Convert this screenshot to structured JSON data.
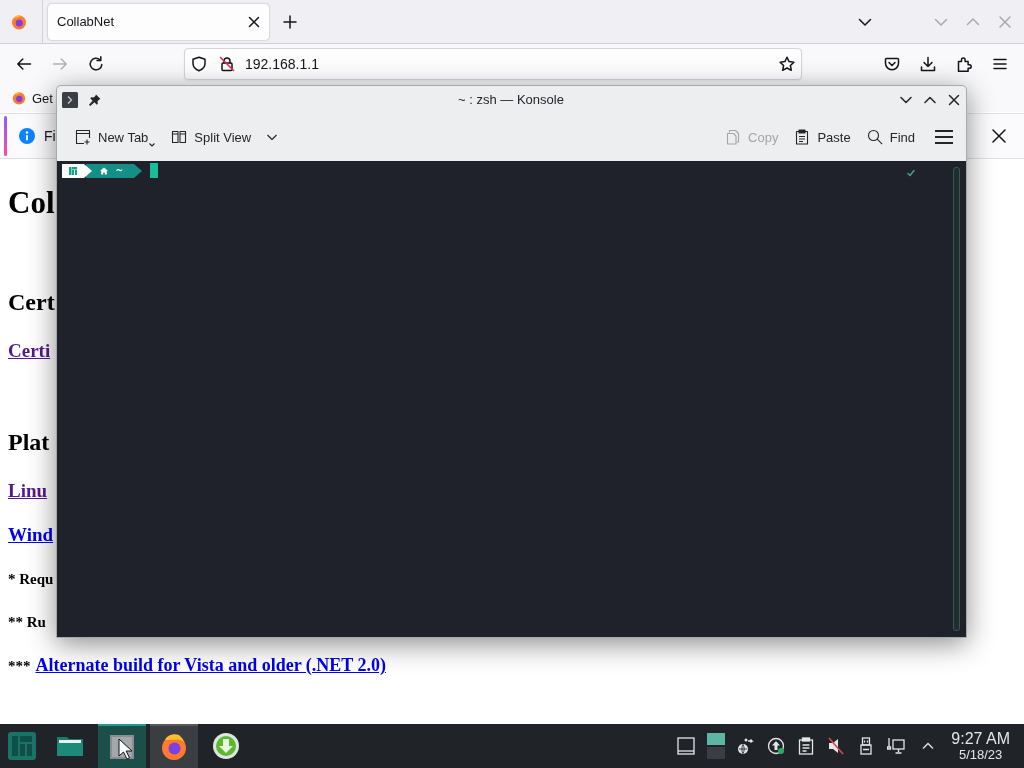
{
  "browser": {
    "tabs": [
      {
        "title": "CollabNet",
        "selected": true
      }
    ],
    "nav_buttons": [
      {
        "kind": "back",
        "disabled": false
      },
      {
        "kind": "forward",
        "disabled": true
      },
      {
        "kind": "reload",
        "disabled": false
      }
    ],
    "url": "192.168.1.1",
    "bookmarked": false,
    "bookmarks": [
      {
        "label": "Get"
      }
    ],
    "notification": {
      "text": "Fi"
    },
    "page": [
      {
        "kind": "h1",
        "text": "Col"
      },
      {
        "kind": "h2",
        "text": "Cert"
      },
      {
        "kind": "link",
        "text": "Certi",
        "visited": true
      },
      {
        "kind": "h2",
        "text": "Plat"
      },
      {
        "kind": "link",
        "text": "Linu",
        "visited": true
      },
      {
        "kind": "link",
        "text": "Wind",
        "visited": false
      },
      {
        "kind": "note",
        "text": "* Requ"
      },
      {
        "kind": "note",
        "text": "** Ru"
      },
      {
        "kind": "note",
        "text": "***",
        "link": "Alternate build for Vista and older (.NET 2.0)",
        "visited": false
      }
    ]
  },
  "konsole": {
    "title": "~ : zsh — Konsole",
    "toolbar_left": [
      {
        "kind": "new-tab",
        "label": "New Tab",
        "disabled": false
      },
      {
        "kind": "split-view",
        "label": "Split View",
        "disabled": false
      }
    ],
    "toolbar_right": [
      {
        "kind": "copy",
        "label": "Copy",
        "disabled": true
      },
      {
        "kind": "paste",
        "label": "Paste",
        "disabled": false
      },
      {
        "kind": "find",
        "label": "Find",
        "disabled": false
      }
    ],
    "prompt": {
      "path": "~"
    },
    "last_command_ok": true
  },
  "taskbar": {
    "tasks": [
      {
        "kind": "files",
        "open": false,
        "active": false
      },
      {
        "kind": "terminal",
        "open": true,
        "active": true
      },
      {
        "kind": "firefox",
        "open": true,
        "active": false
      },
      {
        "kind": "downloader",
        "open": false,
        "active": false
      }
    ],
    "volume_muted": true,
    "clock": {
      "time": "9:27 AM",
      "date": "5/18/23"
    }
  }
}
